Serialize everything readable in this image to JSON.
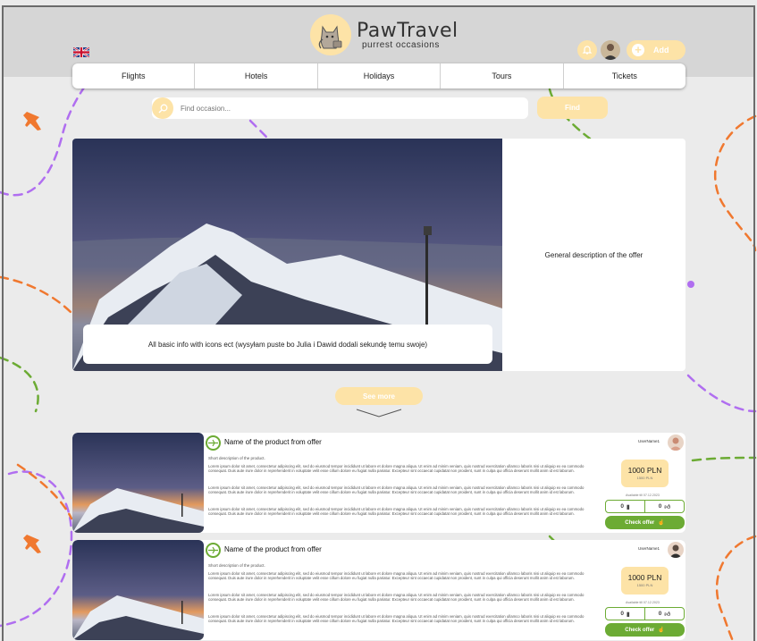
{
  "brand": {
    "title": "PawTravel",
    "subtitle": "purrest occasions"
  },
  "colors": {
    "accent": "#fde3a7",
    "green": "#6cab34",
    "orange": "#f0782f",
    "purple": "#b06ef0"
  },
  "header": {
    "add_label": "Add",
    "language_flag": "flag-uk"
  },
  "nav": {
    "items": [
      {
        "label": "Flights"
      },
      {
        "label": "Hotels"
      },
      {
        "label": "Holidays"
      },
      {
        "label": "Tours"
      },
      {
        "label": "Tickets"
      }
    ]
  },
  "search": {
    "placeholder": "Find occasion...",
    "button_label": "Find"
  },
  "hero": {
    "info": "All basic info with icons ect (wysyłam puste bo Julia i Dawid dodali sekundę temu swoje)",
    "description": "General description of the offer"
  },
  "see_more_label": "See more",
  "offers": [
    {
      "title": "Name of the product from offer",
      "short": "Short description of the product.",
      "lorem": "Lorem ipsum dolor sit amet, consectetur adipiscing elit, sed do eiusmod tempor incididunt ut labore et dolore magna aliqua. Ut enim ad minim veniam, quis nostrud exercitation ullamco laboris nisi ut aliquip ex ea commodo consequat. Duis aute irure dolor in reprehenderit in voluptate velit esse cillum dolore eu fugiat nulla pariatur. Excepteur sint occaecat cupidatat non proident, sunt in culpa qui officia deserunt mollit anim id est laborum.",
      "user": "UserName1",
      "price": "1000 PLN",
      "old_price": "1500 PLN",
      "added": "Available till 07.12.2023",
      "comments": "0",
      "likes": "0",
      "check_label": "Check offer"
    },
    {
      "title": "Name of the product from offer",
      "short": "Short description of the product.",
      "lorem": "Lorem ipsum dolor sit amet, consectetur adipiscing elit, sed do eiusmod tempor incididunt ut labore et dolore magna aliqua. Ut enim ad minim veniam, quis nostrud exercitation ullamco laboris nisi ut aliquip ex ea commodo consequat. Duis aute irure dolor in reprehenderit in voluptate velit esse cillum dolore eu fugiat nulla pariatur. Excepteur sint occaecat cupidatat non proident, sunt in culpa qui officia deserunt mollit anim id est laborum.",
      "user": "UserName1",
      "price": "1000 PLN",
      "old_price": "1500 PLN",
      "added": "Available till 07.12.2023",
      "comments": "0",
      "likes": "0",
      "check_label": "Check offer"
    }
  ]
}
